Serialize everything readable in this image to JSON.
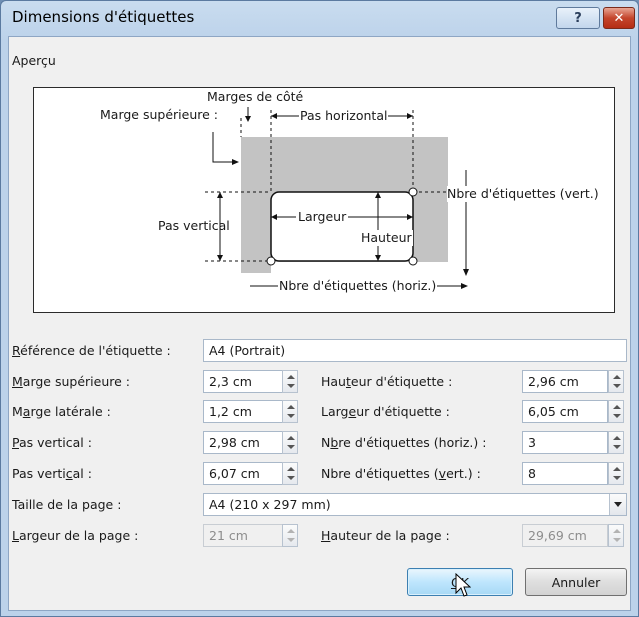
{
  "window": {
    "title": "Dimensions d'étiquettes",
    "help_glyph": "?",
    "close_glyph": "✕"
  },
  "preview": {
    "group_label": "Aperçu",
    "diagram": {
      "marges_cote": "Marges de côté",
      "marge_superieure": "Marge supérieure :",
      "pas_horizontal": "Pas horizontal",
      "nbre_vert": "Nbre d'étiquettes (vert.)",
      "pas_vertical": "Pas vertical",
      "largeur": "Largeur",
      "hauteur": "Hauteur",
      "nbre_horiz": "Nbre d'étiquettes (horiz.)"
    }
  },
  "fields": {
    "reference": {
      "label_pre": "",
      "label_ul": "R",
      "label_post": "éférence de l'étiquette :",
      "value": "A4 (Portrait)"
    },
    "marge_sup": {
      "label_pre": "",
      "label_ul": "M",
      "label_post": "arge supérieure :",
      "value": "2,3 cm"
    },
    "marge_lat": {
      "label_pre": "M",
      "label_ul": "a",
      "label_post": "rge latérale :",
      "value": "1,2 cm"
    },
    "pas_vert1": {
      "label_pre": "",
      "label_ul": "P",
      "label_post": "as vertical :",
      "value": "2,98 cm"
    },
    "pas_vert2": {
      "label_pre": "Pas verti",
      "label_ul": "c",
      "label_post": "al :",
      "value": "6,07 cm"
    },
    "hauteur_etiq": {
      "label_pre": "Hau",
      "label_ul": "t",
      "label_post": "eur d'étiquette :",
      "value": "2,96 cm"
    },
    "largeur_etiq": {
      "label_pre": "Larg",
      "label_ul": "e",
      "label_post": "ur d'étiquette :",
      "value": "6,05 cm"
    },
    "nbre_horiz": {
      "label_pre": "N",
      "label_ul": "b",
      "label_post": "re d'étiquettes (horiz.) :",
      "value": "3"
    },
    "nbre_vert": {
      "label_pre": "Nbre d'étiquettes (",
      "label_ul": "v",
      "label_post": "ert.) :",
      "value": "8"
    },
    "taille_page": {
      "label_pre": "Taille de la page :",
      "label_ul": "",
      "label_post": "",
      "value": "A4 (210 x 297 mm)"
    },
    "largeur_page": {
      "label_pre": "",
      "label_ul": "L",
      "label_post": "argeur de la page :",
      "value": "21 cm"
    },
    "hauteur_page": {
      "label_pre": "",
      "label_ul": "H",
      "label_post": "auteur de la page :",
      "value": "29,69 cm"
    }
  },
  "buttons": {
    "ok_pre": "",
    "ok_ul": "O",
    "ok_post": "K",
    "cancel": "Annuler"
  }
}
